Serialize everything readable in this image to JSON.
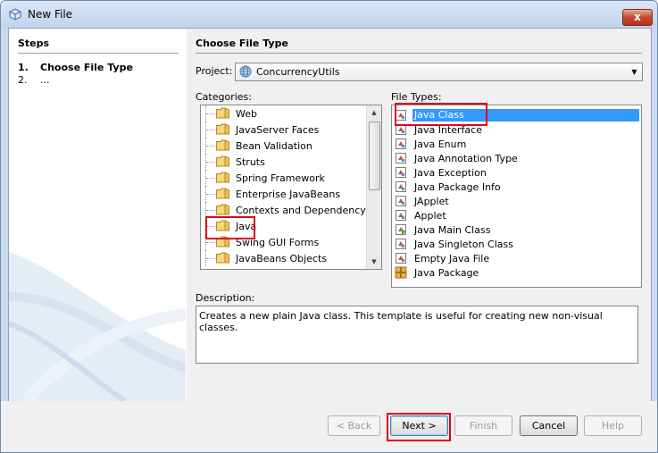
{
  "window": {
    "title": "New File",
    "close_label": "x"
  },
  "steps": {
    "heading": "Steps",
    "items": [
      {
        "num": "1.",
        "label": "Choose File Type"
      },
      {
        "num": "2.",
        "label": "..."
      }
    ]
  },
  "main": {
    "section_title": "Choose File Type",
    "project_label": "Project:",
    "project_value": "ConcurrencyUtils",
    "categories_label": "Categories:",
    "categories": [
      "Web",
      "JavaServer Faces",
      "Bean Validation",
      "Struts",
      "Spring Framework",
      "Enterprise JavaBeans",
      "Contexts and Dependency Injection",
      "Java",
      "Swing GUI Forms",
      "JavaBeans Objects"
    ],
    "selected_category": "Java",
    "file_types_label": "File Types:",
    "file_types": [
      {
        "label": "Java Class",
        "icon": "java-class-icon"
      },
      {
        "label": "Java Interface",
        "icon": "java-interface-icon"
      },
      {
        "label": "Java Enum",
        "icon": "java-enum-icon"
      },
      {
        "label": "Java Annotation Type",
        "icon": "java-annotation-icon"
      },
      {
        "label": "Java Exception",
        "icon": "java-exception-icon"
      },
      {
        "label": "Java Package Info",
        "icon": "java-package-info-icon"
      },
      {
        "label": "JApplet",
        "icon": "japplet-icon"
      },
      {
        "label": "Applet",
        "icon": "applet-icon"
      },
      {
        "label": "Java Main Class",
        "icon": "java-main-class-icon"
      },
      {
        "label": "Java Singleton Class",
        "icon": "java-singleton-icon"
      },
      {
        "label": "Empty Java File",
        "icon": "empty-java-file-icon"
      },
      {
        "label": "Java Package",
        "icon": "java-package-icon"
      }
    ],
    "selected_file_type": "Java Class",
    "description_label": "Description:",
    "description": "Creates a new plain Java class. This template is useful for creating new non-visual classes."
  },
  "buttons": {
    "back": "< Back",
    "next": "Next >",
    "finish": "Finish",
    "cancel": "Cancel",
    "help": "Help"
  },
  "colors": {
    "selection": "#3399ff",
    "highlight_box": "#e0001a",
    "frame": "#c9daee"
  }
}
